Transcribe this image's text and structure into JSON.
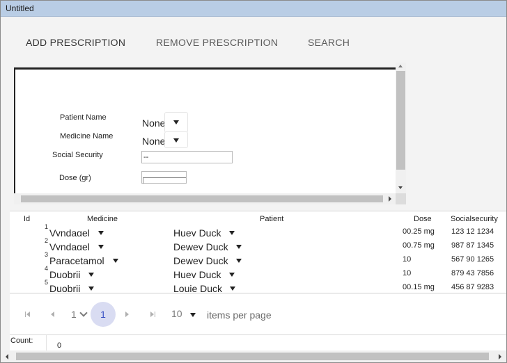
{
  "window": {
    "title": "Untitled"
  },
  "toolbar": {
    "add_label": "ADD PRESCRIPTION",
    "remove_label": "REMOVE PRESCRIPTION",
    "search_label": "SEARCH"
  },
  "form": {
    "patient_name_label": "Patient Name",
    "patient_name_value": "None",
    "medicine_name_label": "Medicine Name",
    "medicine_name_value": "None",
    "social_security_label": "Social Security",
    "social_security_value": "--",
    "dose_label": "Dose (gr)",
    "dose_value": ""
  },
  "grid": {
    "headers": {
      "id": "Id",
      "medicine": "Medicine",
      "patient": "Patient",
      "dose": "Dose",
      "ssn": "Socialsecurity"
    },
    "rows": [
      {
        "id": "1",
        "medicine": "Vyndagel",
        "patient": "Huey Duck",
        "dose": "00.25 mg",
        "ssn": "123 12 1234"
      },
      {
        "id": "2",
        "medicine": "Vyndagel",
        "patient": "Dewey Duck",
        "dose": "00.75 mg",
        "ssn": "987 87 1345"
      },
      {
        "id": "3",
        "medicine": "Paracetamol",
        "patient": "Dewey Duck",
        "dose": "10",
        "ssn": "567 90 1265"
      },
      {
        "id": "4",
        "medicine": "Duobrii",
        "patient": "Huey Duck",
        "dose": "10",
        "ssn": "879 43 7856"
      },
      {
        "id": "5",
        "medicine": "Duobrii",
        "patient": "Louie Duck",
        "dose": "00.15 mg",
        "ssn": "456 87 9283"
      }
    ]
  },
  "pager": {
    "page_select_value": "1",
    "current_page": "1",
    "page_size_value": "10",
    "items_per_page_label": "items per page"
  },
  "footer": {
    "count_label": "Count:",
    "count_value": "0"
  },
  "colors": {
    "titlebar": "#b9cde5",
    "current_page_bg": "#d9dcf2",
    "current_page_text": "#3b53c4"
  },
  "icons": [
    "caret-down-icon",
    "chevron-down-icon",
    "first-page-icon",
    "prev-page-icon",
    "next-page-icon",
    "last-page-icon"
  ]
}
